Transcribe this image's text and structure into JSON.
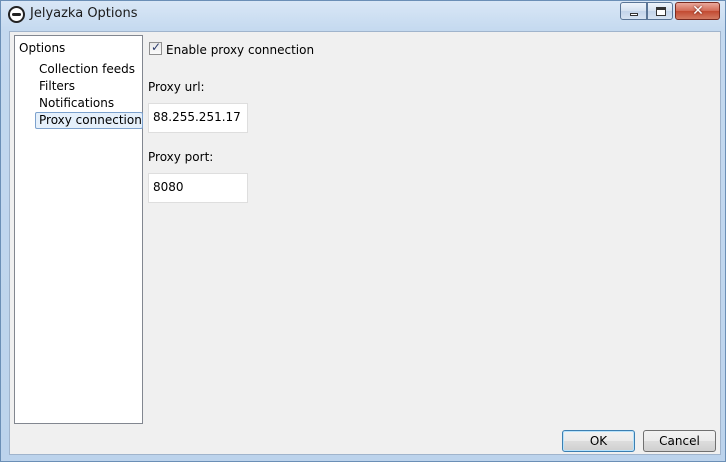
{
  "window": {
    "title": "Jelyazka Options",
    "icon": "jelyazka-logo-icon",
    "controls": [
      "minimize-icon",
      "maximize-icon",
      "close-icon"
    ]
  },
  "tree": {
    "root": "Options",
    "items": [
      {
        "label": "Collection feeds",
        "selected": false
      },
      {
        "label": "Filters",
        "selected": false
      },
      {
        "label": "Notifications",
        "selected": false
      },
      {
        "label": "Proxy connection",
        "selected": true
      }
    ]
  },
  "proxy": {
    "enable_label": "Enable proxy connection",
    "enabled": true,
    "url_label": "Proxy url:",
    "url_value": "88.255.251.17",
    "port_label": "Proxy port:",
    "port_value": "8080"
  },
  "buttons": {
    "ok": "OK",
    "cancel": "Cancel"
  }
}
